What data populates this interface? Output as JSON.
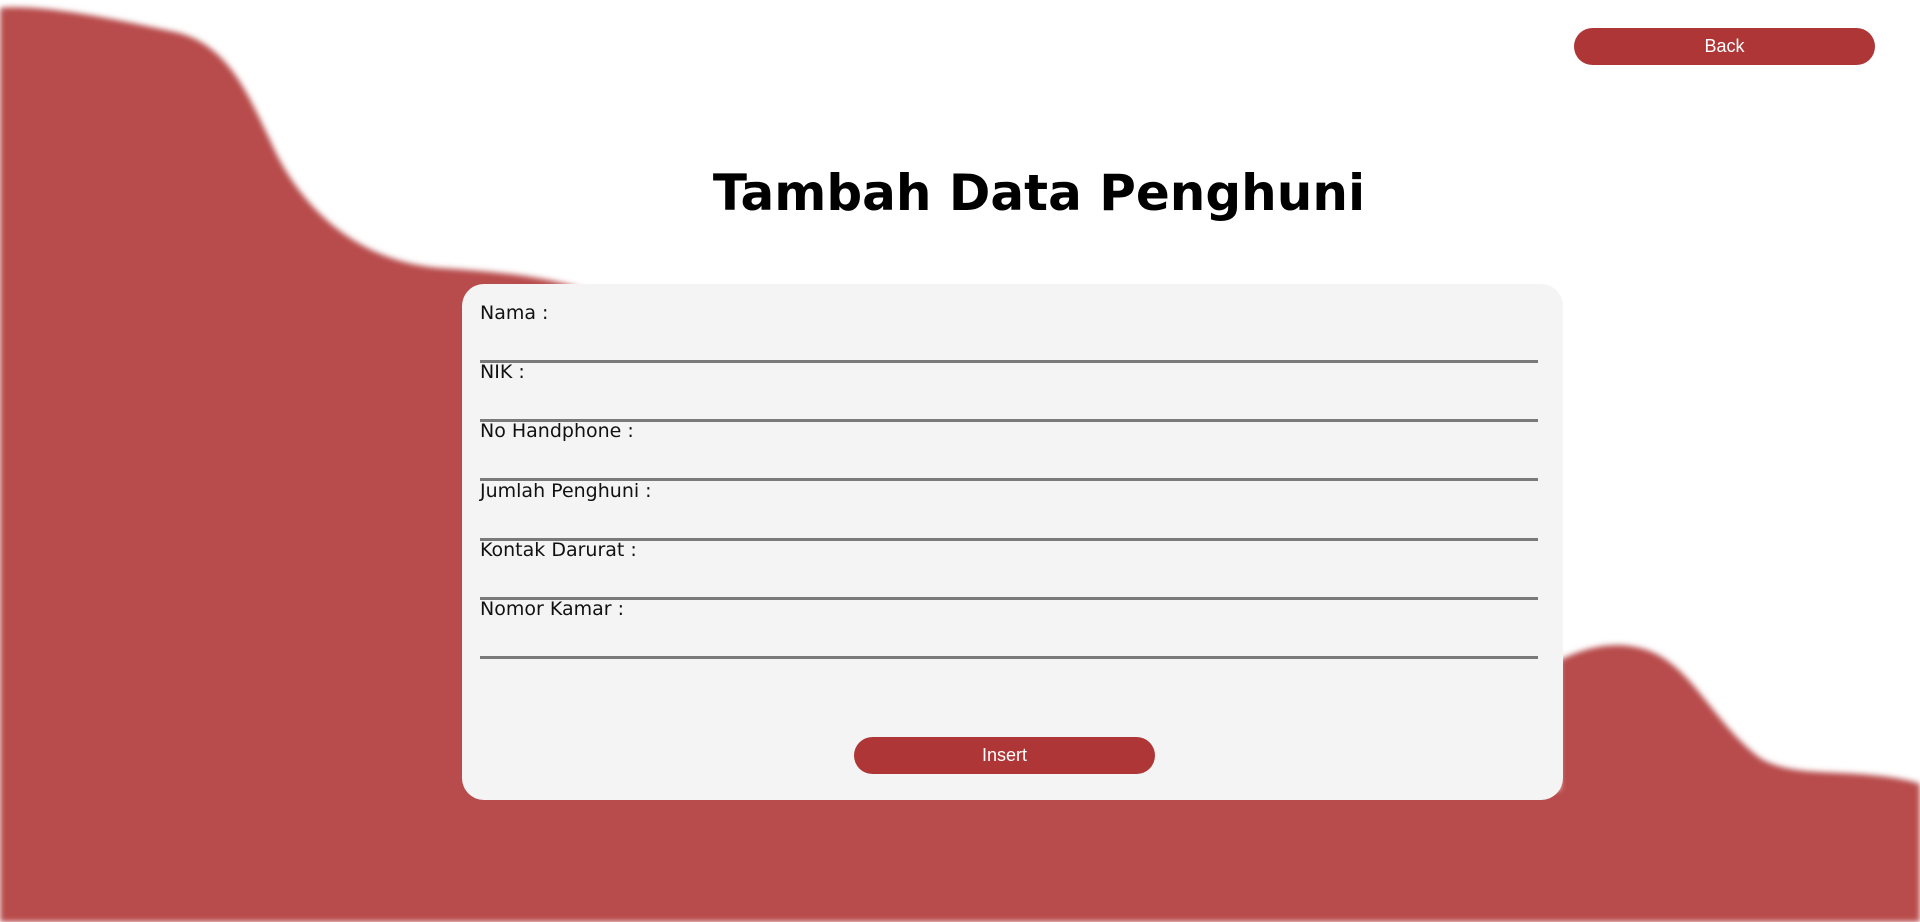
{
  "colors": {
    "accent": "#ae3637",
    "blob": "#b84c4c",
    "card": "#f4f4f4"
  },
  "header": {
    "back_label": "Back"
  },
  "title": "Tambah Data Penghuni",
  "form": {
    "fields": [
      {
        "label": "Nama :",
        "value": ""
      },
      {
        "label": "NIK :",
        "value": ""
      },
      {
        "label": "No Handphone :",
        "value": ""
      },
      {
        "label": "Jumlah Penghuni :",
        "value": ""
      },
      {
        "label": "Kontak Darurat :",
        "value": ""
      },
      {
        "label": "Nomor Kamar :",
        "value": ""
      }
    ],
    "submit_label": "Insert"
  }
}
